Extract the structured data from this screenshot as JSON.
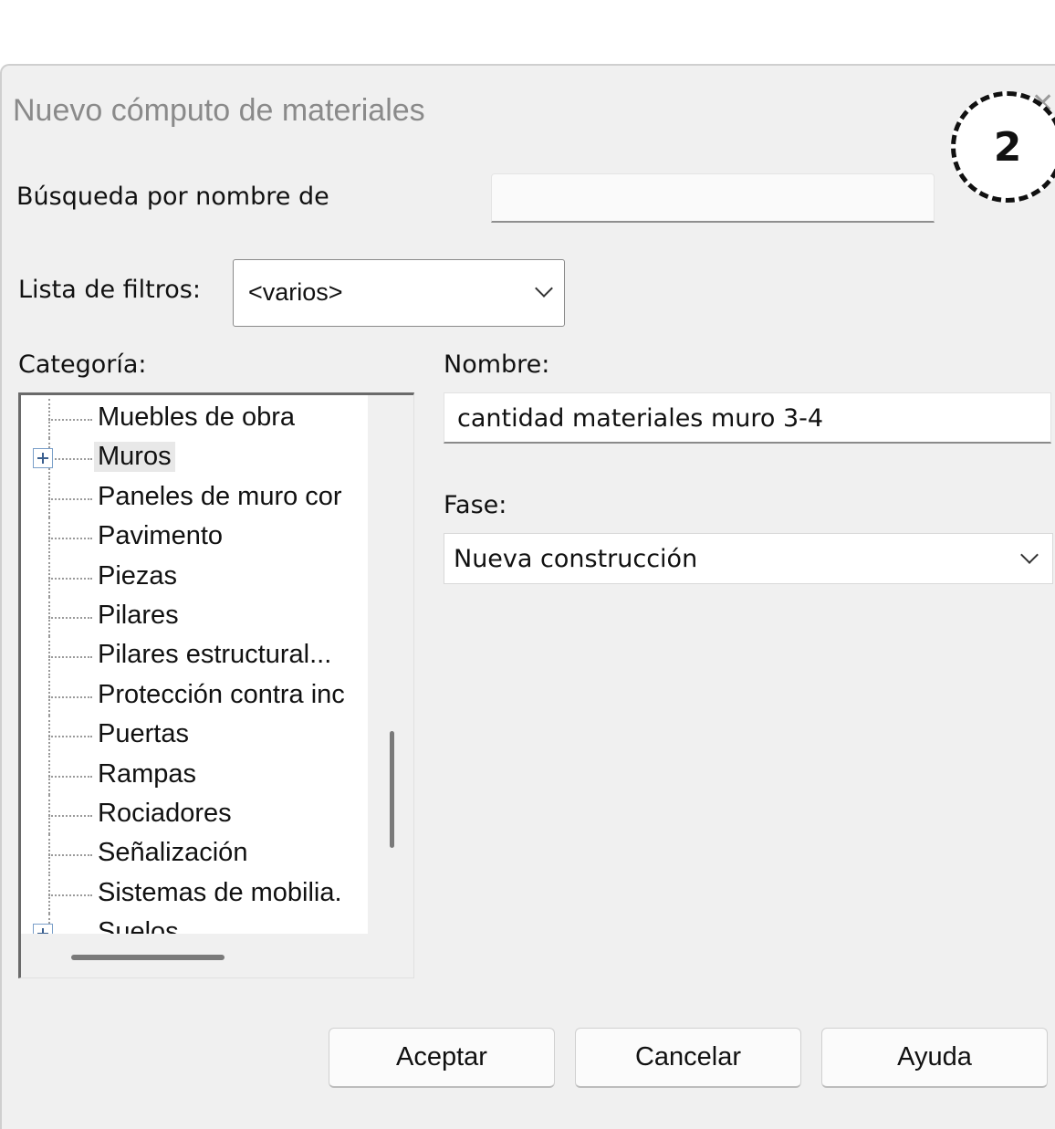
{
  "dialog": {
    "title": "Nuevo cómputo de materiales",
    "badge": "2"
  },
  "search": {
    "label": "Búsqueda por nombre de",
    "value": "",
    "placeholder": ""
  },
  "filters": {
    "label": "Lista de filtros:",
    "selected": "<varios>"
  },
  "category": {
    "label": "Categoría:",
    "items": [
      {
        "label": "Muebles de obra",
        "expandable": false,
        "selected": false
      },
      {
        "label": "Muros",
        "expandable": true,
        "selected": true
      },
      {
        "label": "Paneles de muro cor",
        "expandable": false,
        "selected": false
      },
      {
        "label": "Pavimento",
        "expandable": false,
        "selected": false
      },
      {
        "label": "Piezas",
        "expandable": false,
        "selected": false
      },
      {
        "label": "Pilares",
        "expandable": false,
        "selected": false
      },
      {
        "label": "Pilares estructural...",
        "expandable": false,
        "selected": false
      },
      {
        "label": "Protección contra inc",
        "expandable": false,
        "selected": false
      },
      {
        "label": "Puertas",
        "expandable": false,
        "selected": false
      },
      {
        "label": "Rampas",
        "expandable": false,
        "selected": false
      },
      {
        "label": "Rociadores",
        "expandable": false,
        "selected": false
      },
      {
        "label": "Señalización",
        "expandable": false,
        "selected": false
      },
      {
        "label": "Sistemas de mobilia.",
        "expandable": false,
        "selected": false
      },
      {
        "label": "Suelos",
        "expandable": true,
        "selected": false
      }
    ]
  },
  "name": {
    "label": "Nombre:",
    "value": "cantidad materiales muro 3-4"
  },
  "phase": {
    "label": "Fase:",
    "selected": "Nueva construcción"
  },
  "buttons": {
    "ok": "Aceptar",
    "cancel": "Cancelar",
    "help": "Ayuda"
  }
}
